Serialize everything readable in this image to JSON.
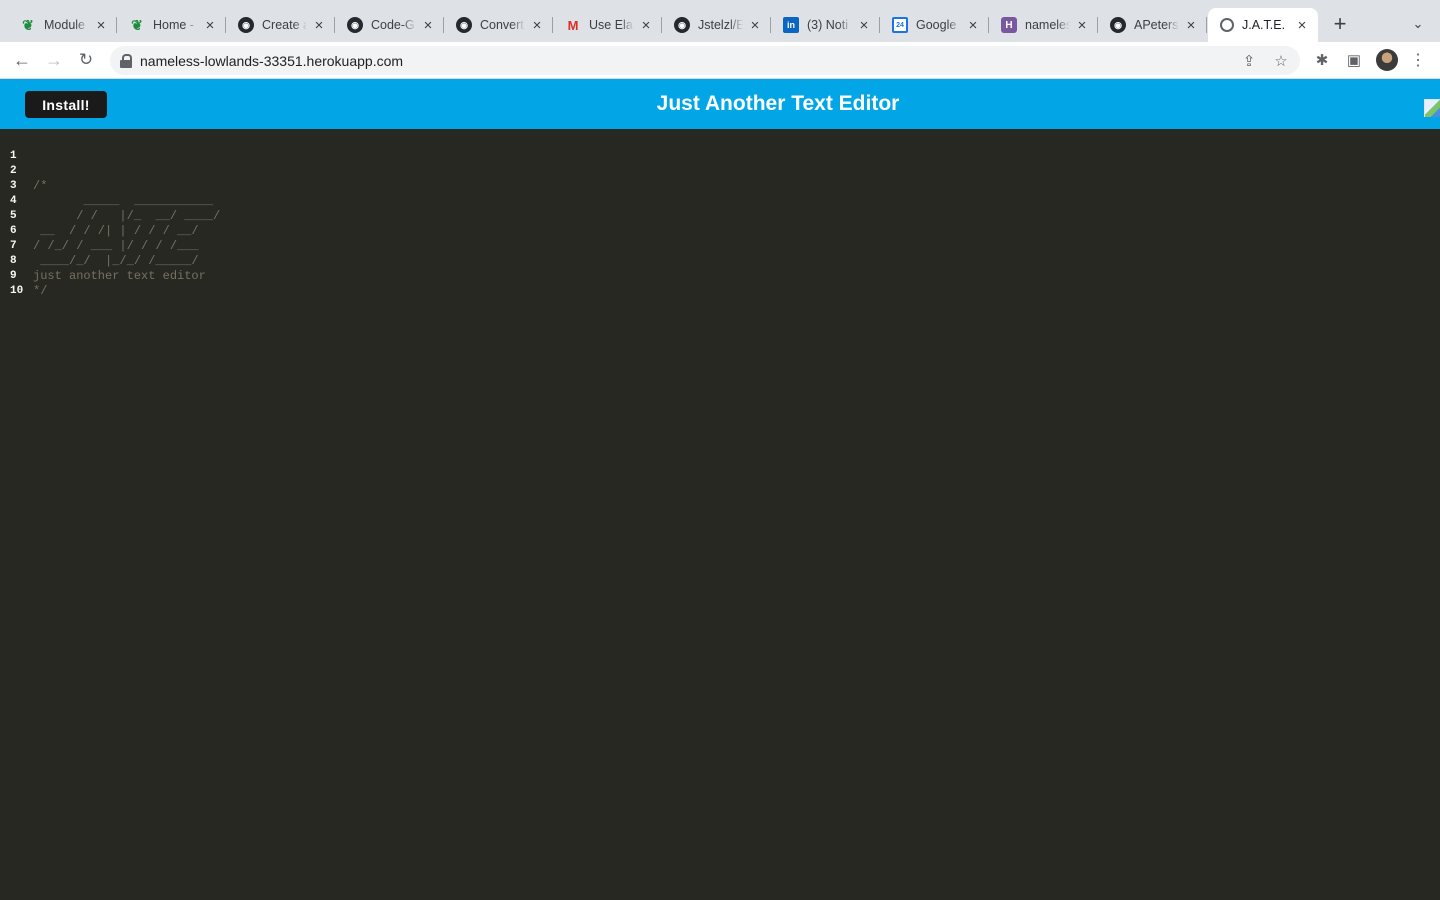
{
  "browser": {
    "tabs": [
      {
        "title": "Module",
        "icon": "leaf-icon",
        "active": false
      },
      {
        "title": "Home -",
        "icon": "leaf-icon",
        "active": false
      },
      {
        "title": "Create a",
        "icon": "github-icon",
        "active": false
      },
      {
        "title": "Code-G",
        "icon": "github-icon",
        "active": false
      },
      {
        "title": "Convert",
        "icon": "github-icon",
        "active": false
      },
      {
        "title": "Use Ela",
        "icon": "gmail-icon",
        "active": false
      },
      {
        "title": "Jstelzl/E",
        "icon": "github-icon",
        "active": false
      },
      {
        "title": "(3) Noti",
        "icon": "linkedin-icon",
        "active": false
      },
      {
        "title": "Google",
        "icon": "calendar-icon",
        "active": false
      },
      {
        "title": "nameles",
        "icon": "heroku-icon",
        "active": false
      },
      {
        "title": "APeters",
        "icon": "github-icon",
        "active": false
      },
      {
        "title": "J.A.T.E.",
        "icon": "globe-icon",
        "active": true
      }
    ],
    "favicon_glyphs": {
      "leaf": "❦",
      "github": "◉",
      "gmail": "M",
      "linkedin": "in",
      "calendar": "24",
      "heroku": "H"
    },
    "url": "nameless-lowlands-33351.herokuapp.com"
  },
  "app": {
    "install_label": "Install!",
    "title": "Just Another Text Editor",
    "accent_color": "#02a6e6"
  },
  "editor": {
    "background_color": "#272822",
    "comment_color": "#75715e",
    "lines": [
      {
        "number": "1",
        "text": ""
      },
      {
        "number": "2",
        "text": "/*"
      },
      {
        "number": "3",
        "text": "       _____  ___________"
      },
      {
        "number": "4",
        "text": "      / /   |/_  __/ ____/"
      },
      {
        "number": "5",
        "text": " __  / / /| | / / / __/"
      },
      {
        "number": "6",
        "text": "/ /_/ / ___ |/ / / /___"
      },
      {
        "number": "7",
        "text": " ____/_/  |_/_/ /_____/"
      },
      {
        "number": "8",
        "text": "just another text editor"
      },
      {
        "number": "9",
        "text": "*/"
      },
      {
        "number": "10",
        "text": ""
      }
    ]
  }
}
